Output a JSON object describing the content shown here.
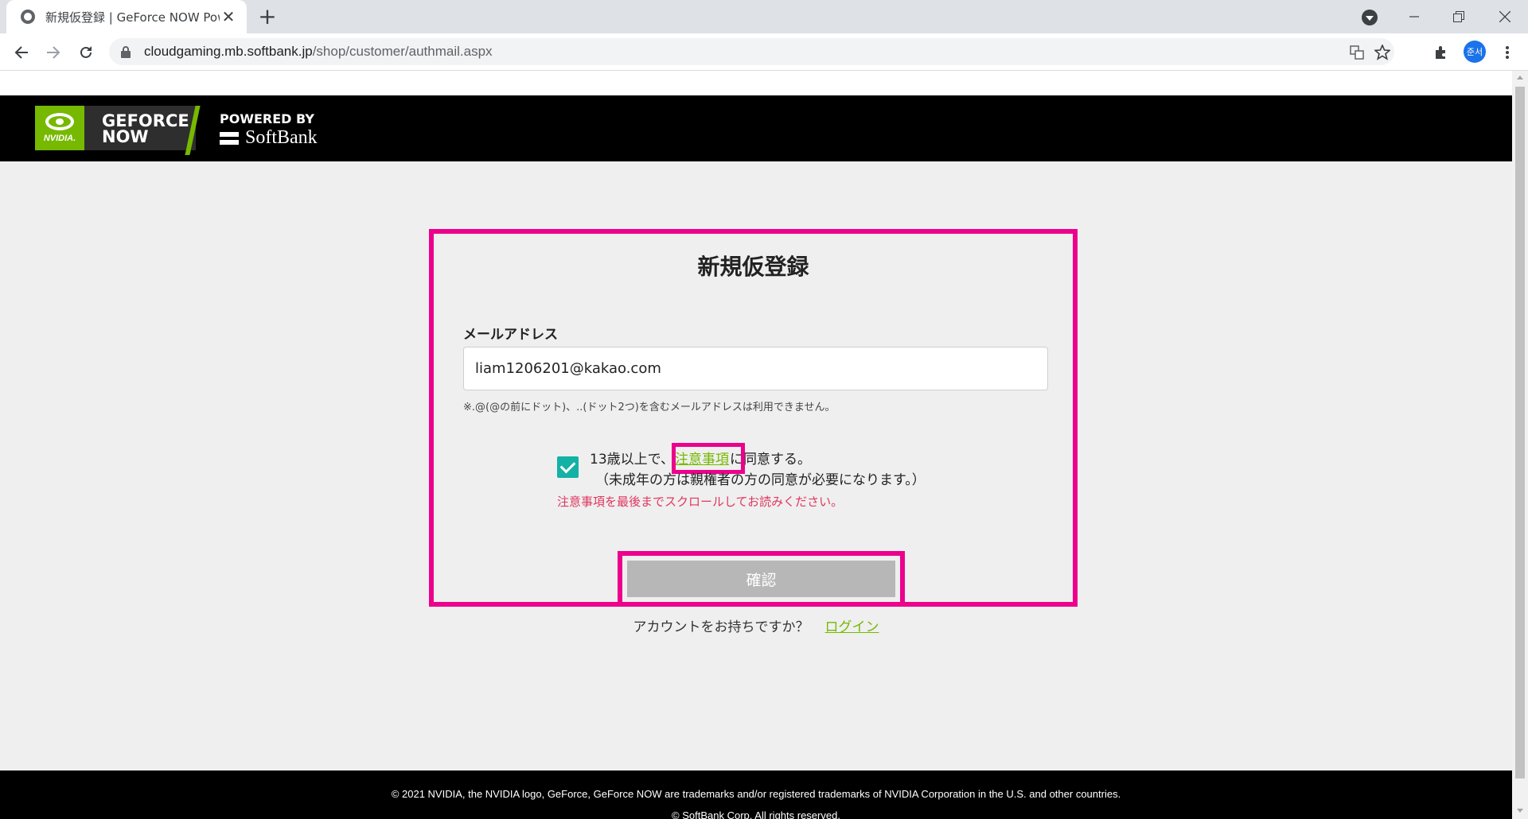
{
  "browser": {
    "tab_title": "新規仮登録 | GeForce NOW Pow",
    "tab_close": "✕",
    "new_tab": "+",
    "url_host": "cloudgaming.mb.softbank.jp",
    "url_path": "/shop/customer/authmail.aspx",
    "profile_initials": "준서"
  },
  "header": {
    "logo_nvidia": "NVIDIA.",
    "logo_geforce_line1": "GEFORCE",
    "logo_geforce_line2": "NOW",
    "powered_by": "POWERED BY",
    "softbank": "SoftBank"
  },
  "form": {
    "title": "新規仮登録",
    "email_label": "メールアドレス",
    "email_value": "liam1206201@kakao.com",
    "email_note": "※.@(@の前にドット)、..(ドット2つ)を含むメールアドレスは利用できません。",
    "agree_prefix": "13歳以上で、",
    "terms_link": "注意事項",
    "agree_suffix": "に同意する。",
    "agree_line2": "（未成年の方は親権者の方の同意が必要になります。）",
    "warning": "注意事項を最後までスクロールしてお読みください。",
    "confirm_button": "確認",
    "checkbox_checked": true
  },
  "account": {
    "question": "アカウントをお持ちですか？",
    "login_link": "ログイン"
  },
  "footer": {
    "line1": "© 2021 NVIDIA, the NVIDIA logo, GeForce, GeForce NOW are trademarks and/or registered trademarks of NVIDIA Corporation in the U.S. and other countries.",
    "line2": "© SoftBank Corp. All rights reserved."
  },
  "colors": {
    "nvidia_green": "#76b900",
    "highlight_magenta": "#ec008c",
    "checkbox_teal": "#14b1a6",
    "warning_red": "#e0365f"
  }
}
